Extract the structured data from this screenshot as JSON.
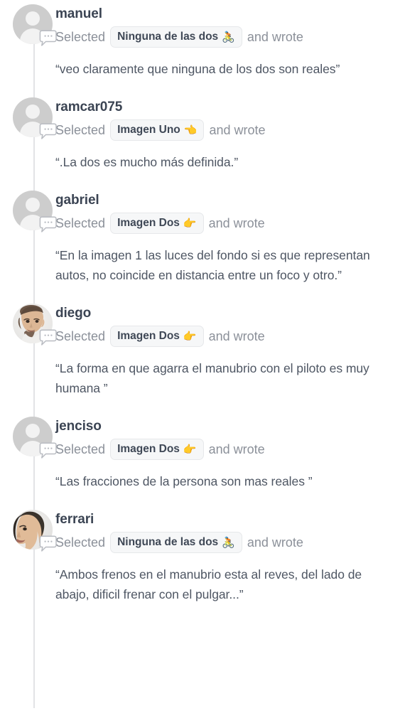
{
  "feed": {
    "labels": {
      "selected_prefix": "Selected",
      "selected_suffix": "and wrote"
    },
    "colors": {
      "username": "#3b4453",
      "meta": "#8b9099",
      "quote": "#4e5663",
      "chip_bg": "#f6f7f8",
      "chip_border": "#e6e8ea",
      "thread_line": "#e2e3e6",
      "avatar_bg": "#cdcdcd"
    },
    "comments": [
      {
        "username": "manuel",
        "avatar_type": "silhouette",
        "avatar_icon": "default-user-avatar-icon",
        "badge_icon": "comment-bubble-icon",
        "selected_prefix": "Selected",
        "choice_label": "Ninguna de las dos",
        "choice_emoji": "🚴",
        "choice_emoji_name": "cyclist-emoji",
        "selected_suffix": "and wrote",
        "quote": "“veo claramente que ninguna de los dos son reales”"
      },
      {
        "username": "ramcar075",
        "avatar_type": "silhouette",
        "avatar_icon": "default-user-avatar-icon",
        "badge_icon": "comment-bubble-icon",
        "selected_prefix": "Selected",
        "choice_label": "Imagen Uno",
        "choice_emoji": "👈",
        "choice_emoji_name": "point-left-emoji",
        "selected_suffix": "and wrote",
        "quote": "“.La dos es mucho más definida.”"
      },
      {
        "username": "gabriel",
        "avatar_type": "silhouette",
        "avatar_icon": "default-user-avatar-icon",
        "badge_icon": "comment-bubble-icon",
        "selected_prefix": "Selected",
        "choice_label": "Imagen Dos",
        "choice_emoji": "👉",
        "choice_emoji_name": "point-right-emoji",
        "selected_suffix": "and wrote",
        "quote": "“En la imagen 1 las luces del fondo si es que representan autos, no coincide en distancia entre un foco y otro.”"
      },
      {
        "username": "diego",
        "avatar_type": "photo-bearded-man",
        "avatar_icon": "user-photo-avatar-icon",
        "badge_icon": "comment-bubble-icon",
        "selected_prefix": "Selected",
        "choice_label": "Imagen Dos",
        "choice_emoji": "👉",
        "choice_emoji_name": "point-right-emoji",
        "selected_suffix": "and wrote",
        "quote": "“La forma en que agarra el manubrio con el piloto es muy humana ”"
      },
      {
        "username": "jenciso",
        "avatar_type": "silhouette",
        "avatar_icon": "default-user-avatar-icon",
        "badge_icon": "comment-bubble-icon",
        "selected_prefix": "Selected",
        "choice_label": "Imagen Dos",
        "choice_emoji": "👉",
        "choice_emoji_name": "point-right-emoji",
        "selected_suffix": "and wrote",
        "quote": "“Las fracciones de la persona son mas reales ”"
      },
      {
        "username": "ferrari",
        "avatar_type": "photo-profile-man",
        "avatar_icon": "user-photo-avatar-icon",
        "badge_icon": "comment-bubble-icon",
        "selected_prefix": "Selected",
        "choice_label": "Ninguna de las dos",
        "choice_emoji": "🚴",
        "choice_emoji_name": "cyclist-emoji",
        "selected_suffix": "and wrote",
        "quote": "“Ambos frenos en el manubrio esta al reves, del lado de abajo, dificil frenar con el pulgar...”"
      }
    ]
  }
}
